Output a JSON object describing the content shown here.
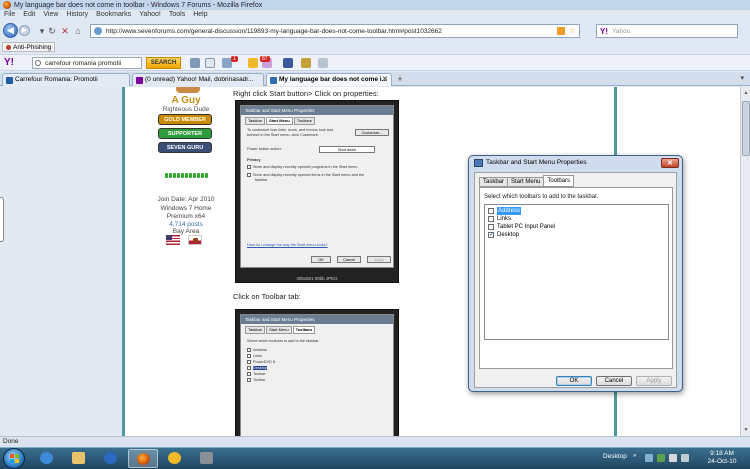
{
  "window": {
    "title": "My language bar does not come in toolbar - Windows 7 Forums - Mozilla Firefox"
  },
  "menu": [
    "File",
    "Edit",
    "View",
    "History",
    "Bookmarks",
    "Yahoo!",
    "Tools",
    "Help"
  ],
  "nav": {
    "url": "http://www.sevenforums.com/general-discussion/119893-my-language-bar-does-not-come-toolbar.html#post1032662",
    "search_placeholder": "Yahoo",
    "search_logo": "Y!"
  },
  "bookmarks": {
    "anti_phishing": "Anti-Phishing"
  },
  "yahoo_toolbar": {
    "logo": "Y!",
    "query": "carrefour romania promotii",
    "search_label": "SEARCH",
    "mail_count": "1",
    "news_count": "87"
  },
  "tabs": [
    {
      "label": "Carrefour Romania: Promotii",
      "color": "#1f5aa6"
    },
    {
      "label": "(0 unread) Yahoo! Mail, dobrinasadr...",
      "color": "#7b0099"
    },
    {
      "label": "My language bar does not come i...",
      "color": "#2f6db5",
      "active": true
    }
  ],
  "user": {
    "name": "A Guy",
    "rank": "Righteous Dude",
    "badges": [
      {
        "label": "GOLD MEMBER",
        "color": "#c98a00"
      },
      {
        "label": "SUPPORTER",
        "color": "#2f9b3a"
      },
      {
        "label": "SEVEN GURU",
        "color": "#3d4f77"
      }
    ],
    "join_date": "Join Date: Apr 2010",
    "os_line1": "Windows 7 Home",
    "os_line2": "Premium x64",
    "posts": "4,714 posts",
    "location": "Bay Area"
  },
  "post": {
    "line1": "Right click Start button> Click on properties:",
    "line2": "Click on Toolbar tab:",
    "shot1": {
      "title": "Taskbar and Start Menu Properties",
      "tabs": [
        "Taskbar",
        "Start Menu",
        "Toolbars"
      ],
      "text1": "To customize how links, icons, and menus look and",
      "text2": "behave in the Start menu, click Customize.",
      "customize": "Customize...",
      "power_label": "Power button action:",
      "power_value": "Shut down",
      "privacy": "Privacy",
      "priv1": "Store and display recently opened programs in the Start menu",
      "priv2a": "Store and display recently opened items in the Start menu and the",
      "priv2b": "taskbar",
      "link": "How do I change the way the Start menu looks?",
      "ok": "OK",
      "cancel": "Cancel",
      "apply": "Apply",
      "caption": "405x501  90kb  JPEG"
    },
    "shot2": {
      "title": "Taskbar and Start Menu Properties",
      "tabs": [
        "Taskbar",
        "Start Menu",
        "Toolbars"
      ],
      "prompt": "Select which toolbars to add to the taskbar.",
      "items": [
        "Address",
        "Links",
        "PowerDVD 8",
        "Desktop",
        "Toolbar",
        "Toolbar"
      ]
    }
  },
  "dialog": {
    "title": "Taskbar and Start Menu Properties",
    "tabs": [
      "Taskbar",
      "Start Menu",
      "Toolbars"
    ],
    "active_tab": "Toolbars",
    "prompt": "Select which toolbars to add to the taskbar.",
    "items": [
      {
        "label": "Address",
        "checked": false,
        "selected": true
      },
      {
        "label": "Links",
        "checked": false
      },
      {
        "label": "Tablet PC Input Panel",
        "checked": false
      },
      {
        "label": "Desktop",
        "checked": true
      }
    ],
    "ok": "OK",
    "cancel": "Cancel",
    "apply": "Apply"
  },
  "status": {
    "text": "Done"
  },
  "taskbar": {
    "desktop_label": "Desktop",
    "time": "9:18 AM",
    "date": "24-Oct-10"
  }
}
